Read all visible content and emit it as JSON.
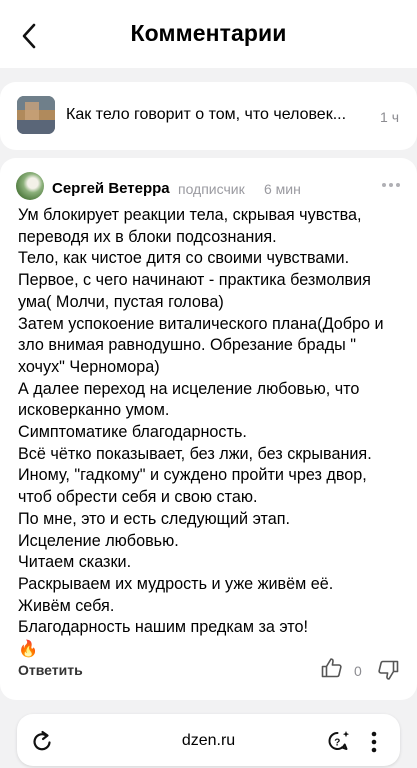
{
  "header": {
    "title": "Комментарии",
    "back_icon": "chevron-left-icon"
  },
  "article": {
    "title": "Как тело говорит о том, что человек...",
    "time": "1 ч"
  },
  "comment": {
    "author": "Сергей Ветерра",
    "role": "подписчик",
    "time_ago": "6 мин",
    "lines": [
      "Ум блокирует реакции тела, скрывая чувства,",
      "переводя их в блоки подсознания.",
      "Тело, как чистое дитя со своими чувствами.",
      "Первое, с чего начинают - практика безмолвия",
      "ума( Молчи, пустая голова)",
      "Затем успокоение виталического плана(Добро и",
      "зло внимая равнодушно. Обрезание брады \"",
      "хочух\" Черномора)",
      "А далее переход на исцеление любовью, что",
      "исковерканно умом.",
      "Симптоматике благодарность.",
      "Всё чётко показывает, без лжи, без скрывания.",
      "Иному, \"гадкому\" и суждено пройти чрез двор,",
      "чтоб обрести себя и свою стаю.",
      "По мне, это и есть следующий этап.",
      "Исцеление любовью.",
      "Читаем сказки.",
      "Раскрываем их мудрость и уже живём её.",
      "Живём себя.",
      "Благодарность нашим предкам за это!",
      "🔥"
    ],
    "reply_label": "Ответить",
    "likes": "0"
  },
  "browser": {
    "url": "dzen.ru"
  },
  "colors": {
    "background": "#f2f2f3",
    "card": "#ffffff",
    "muted_text": "#8c8c91"
  }
}
